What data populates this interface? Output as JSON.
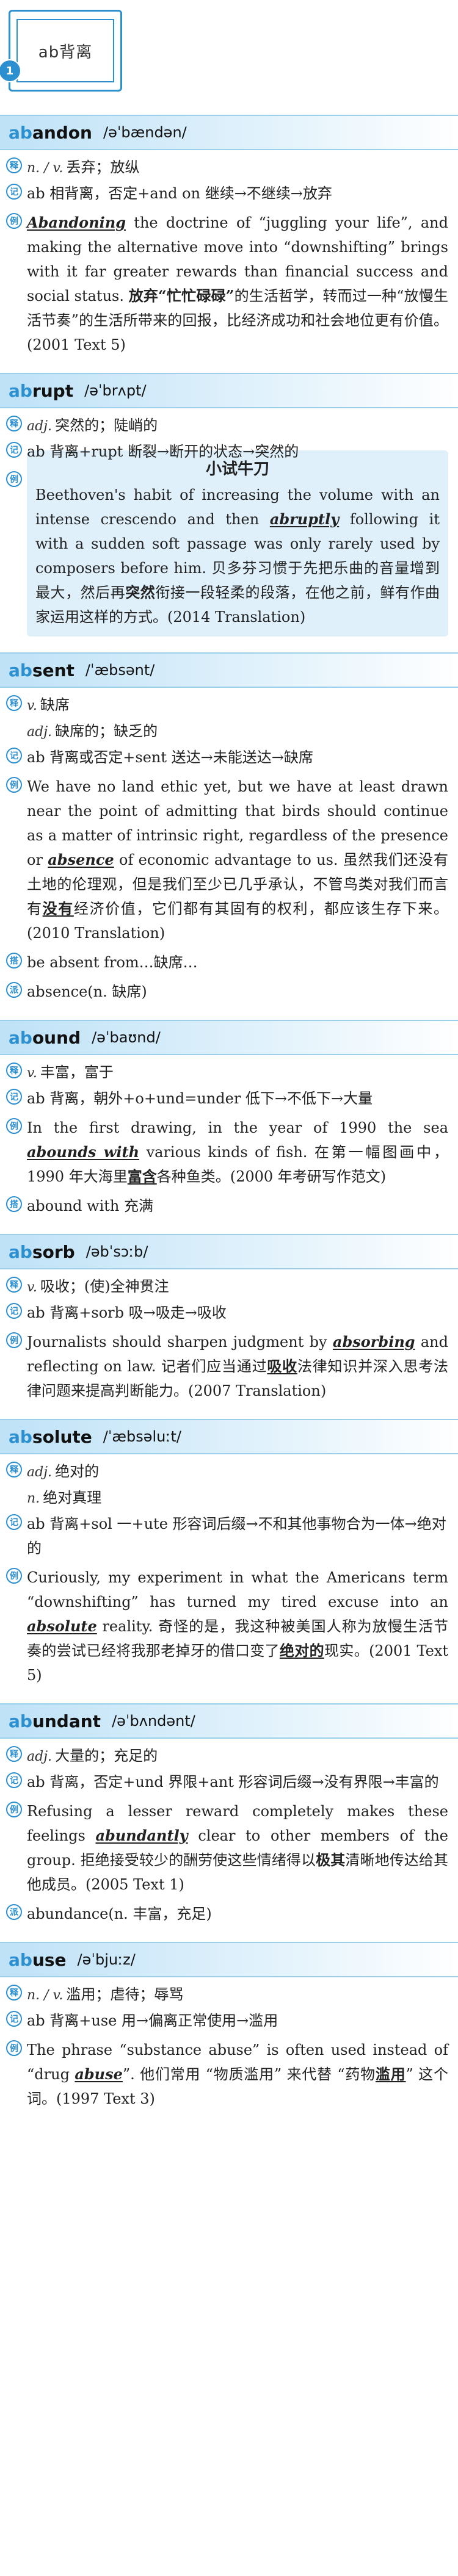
{
  "header": {
    "title": "ab背离",
    "index": "1"
  },
  "entries": {
    "abandon": {
      "word_prefix": "ab",
      "word_rest": "andon",
      "phonetic": "/əˈbændən/",
      "pos": "n. / v.",
      "meaning": "丢弃；放纵",
      "etym": "ab 相背离，否定+and on 继续→不继续→放弃",
      "ex_em": "Abandoning",
      "ex_1": " the doctrine of “juggling your life”, and making the alternative move into “downshifting” brings with it far greater rewards than financial success and social status. ",
      "ex_hl": "放弃“忙忙碌碌”",
      "ex_2": "的生活哲学，转而过一种“放慢生活节奏”的生活所带来的回报，比经济成功和社会地位更有价值。(2001 Text 5)"
    },
    "abrupt": {
      "word_prefix": "ab",
      "word_rest": "rupt",
      "phonetic": "/əˈbrʌpt/",
      "pos": "adj.",
      "meaning": "突然的；陡峭的",
      "etym": "ab 背离+rupt 断裂→断开的状态→突然的",
      "note_title": "小试牛刀",
      "ex_1": "Beethoven's habit of increasing the volume with an intense crescendo and then ",
      "ex_em": "abruptly",
      "ex_2": " following it with a sudden soft passage was only rarely used by composers before him. 贝多芬习惯于先把乐曲的音量增到最大，然后再",
      "ex_hl": "突然",
      "ex_3": "衔接一段轻柔的段落，在他之前，鲜有作曲家运用这样的方式。(2014 Translation)"
    },
    "absent": {
      "word_prefix": "ab",
      "word_rest": "sent",
      "phonetic": "/ˈæbsənt/",
      "pos1": "v.",
      "meaning1": "缺席",
      "pos2": "adj.",
      "meaning2": "缺席的；缺乏的",
      "etym": "ab 背离或否定+sent 送达→未能送达→缺席",
      "ex_1": "We have no land ethic yet, but we have at least drawn near the point of admitting that birds should continue as a matter of intrinsic right, regardless of the presence or ",
      "ex_em": "absence",
      "ex_2": " of economic advantage to us. 虽然我们还没有土地的伦理观，但是我们至少已几乎承认，不管鸟类对我们而言有",
      "ex_hl": "没有",
      "ex_3": "经济价值，它们都有其固有的权利，都应该生存下来。(2010 Translation)",
      "phrase": "be absent from…缺席…",
      "deriv": "absence(n. 缺席)"
    },
    "abound": {
      "word_prefix": "ab",
      "word_rest": "ound",
      "phonetic": "/əˈbaʊnd/",
      "pos": "v.",
      "meaning": "丰富，富于",
      "etym": "ab 背离，朝外+o+und=under 低下→不低下→大量",
      "ex_1": "In the first drawing, in the year of 1990 the sea ",
      "ex_em": "abounds with",
      "ex_2": " various kinds of fish. 在第一幅图画中，1990 年大海里",
      "ex_hl": "富含",
      "ex_3": "各种鱼类。(2000 年考研写作范文)",
      "phrase": "abound with 充满"
    },
    "absorb": {
      "word_prefix": "ab",
      "word_rest": "sorb",
      "phonetic": "/əbˈsɔːb/",
      "pos": "v.",
      "meaning": "吸收；(使)全神贯注",
      "etym": "ab 背离+sorb 吸→吸走→吸收",
      "ex_1": "Journalists should sharpen judgment by ",
      "ex_em": "absorbing",
      "ex_2": " and reflecting on law. 记者们应当通过",
      "ex_hl": "吸收",
      "ex_3": "法律知识并深入思考法律问题来提高判断能力。(2007 Translation)"
    },
    "absolute": {
      "word_prefix": "ab",
      "word_rest": "solute",
      "phonetic": "/ˈæbsəluːt/",
      "pos1": "adj.",
      "meaning1": "绝对的",
      "pos2": "n.",
      "meaning2": "绝对真理",
      "etym": "ab 背离+sol 一+ute 形容词后缀→不和其他事物合为一体→绝对的",
      "ex_1": "Curiously, my experiment in what the Americans term “downshifting” has turned my tired excuse into an ",
      "ex_em": "absolute",
      "ex_2": " reality. 奇怪的是，我这种被美国人称为放慢生活节奏的尝试已经将我那老掉牙的借口变了",
      "ex_hl": "绝对的",
      "ex_3": "现实。(2001 Text 5)"
    },
    "abundant": {
      "word_prefix": "ab",
      "word_rest": "undant",
      "phonetic": "/əˈbʌndənt/",
      "pos": "adj.",
      "meaning": "大量的；充足的",
      "etym": "ab 背离，否定+und 界限+ant 形容词后缀→没有界限→丰富的",
      "ex_1": "Refusing a lesser reward completely makes these feelings ",
      "ex_em": "abundantly",
      "ex_2": " clear to other members of the group. 拒绝接受较少的酬劳使这些情绪得以",
      "ex_hl": "极其",
      "ex_3": "清晰地传达给其他成员。(2005 Text 1)",
      "deriv": "abundance(n. 丰富，充足)"
    },
    "abuse": {
      "word_prefix": "ab",
      "word_rest": "use",
      "phonetic": "/əˈbjuːz/",
      "pos": "n. / v.",
      "meaning": "滥用；虐待；辱骂",
      "etym": "ab 背离+use 用→偏离正常使用→滥用",
      "ex_1": "The phrase “substance abuse” is often used instead of “drug ",
      "ex_em": "abuse",
      "ex_2": "”. 他们常用 “物质滥用” 来代替 “药物",
      "ex_hl": "滥用",
      "ex_3": "” 这个词。(1997 Text 3)"
    }
  },
  "tags": {
    "pos": "释",
    "etym": "记",
    "example": "例",
    "phrase": "搭",
    "deriv": "派"
  },
  "colors": {
    "accent": "#2c8fd0",
    "bar": "#bfe2f7",
    "note": "#dff0fb"
  }
}
